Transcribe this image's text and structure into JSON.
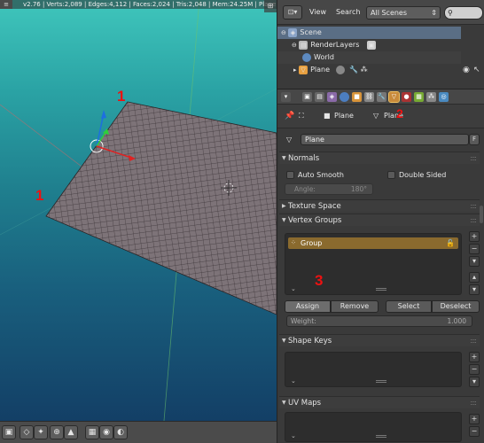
{
  "viewport": {
    "header_info": "v2.76 | Verts:2,089 | Edges:4,112 | Faces:2,024 | Tris:2,048 | Mem:24.25M | Plane",
    "corner_icon": "grid-icon",
    "annotations": [
      "1",
      "1",
      "2",
      "3"
    ],
    "toolbar_icons": [
      "view-mode-icon",
      "mesh-icon",
      "tool-icon",
      "snap-icon",
      "render-icon",
      "layers-icon",
      "camera-icon",
      "overlay-icon"
    ]
  },
  "outliner": {
    "menu": [
      "View",
      "Search"
    ],
    "scenes_dropdown": "All Scenes",
    "search_placeholder": "",
    "tree": [
      {
        "label": "Scene",
        "icon": "scene-icon"
      },
      {
        "label": "RenderLayers",
        "icon": "render-layers-icon"
      },
      {
        "label": "World",
        "icon": "world-icon"
      },
      {
        "label": "Plane",
        "icon": "object-icon"
      }
    ]
  },
  "properties": {
    "tab_icons": [
      "render-icon",
      "render-layer-icon",
      "scene-icon",
      "world-icon",
      "object-icon",
      "constraint-icon",
      "modifier-icon",
      "data-icon",
      "material-icon",
      "texture-icon",
      "particles-icon",
      "physics-icon"
    ],
    "breadcrumb": {
      "object": "Plane",
      "data": "Plane"
    },
    "data_name": "Plane",
    "data_name_btn": "F",
    "normals": {
      "title": "Normals",
      "auto_smooth": "Auto Smooth",
      "double_sided": "Double Sided",
      "angle_label": "Angle:",
      "angle_value": "180°"
    },
    "texture_space": {
      "title": "Texture Space"
    },
    "vertex_groups": {
      "title": "Vertex Groups",
      "items": [
        "Group"
      ],
      "assign": "Assign",
      "remove": "Remove",
      "select": "Select",
      "deselect": "Deselect",
      "weight_label": "Weight:",
      "weight_value": "1.000"
    },
    "shape_keys": {
      "title": "Shape Keys"
    },
    "uv_maps": {
      "title": "UV Maps"
    }
  },
  "colors": {
    "annotation": "#ee1111",
    "selected_group": "#8a6a2e",
    "viewport_top": "#3fc6bc",
    "viewport_bottom": "#133f66"
  }
}
